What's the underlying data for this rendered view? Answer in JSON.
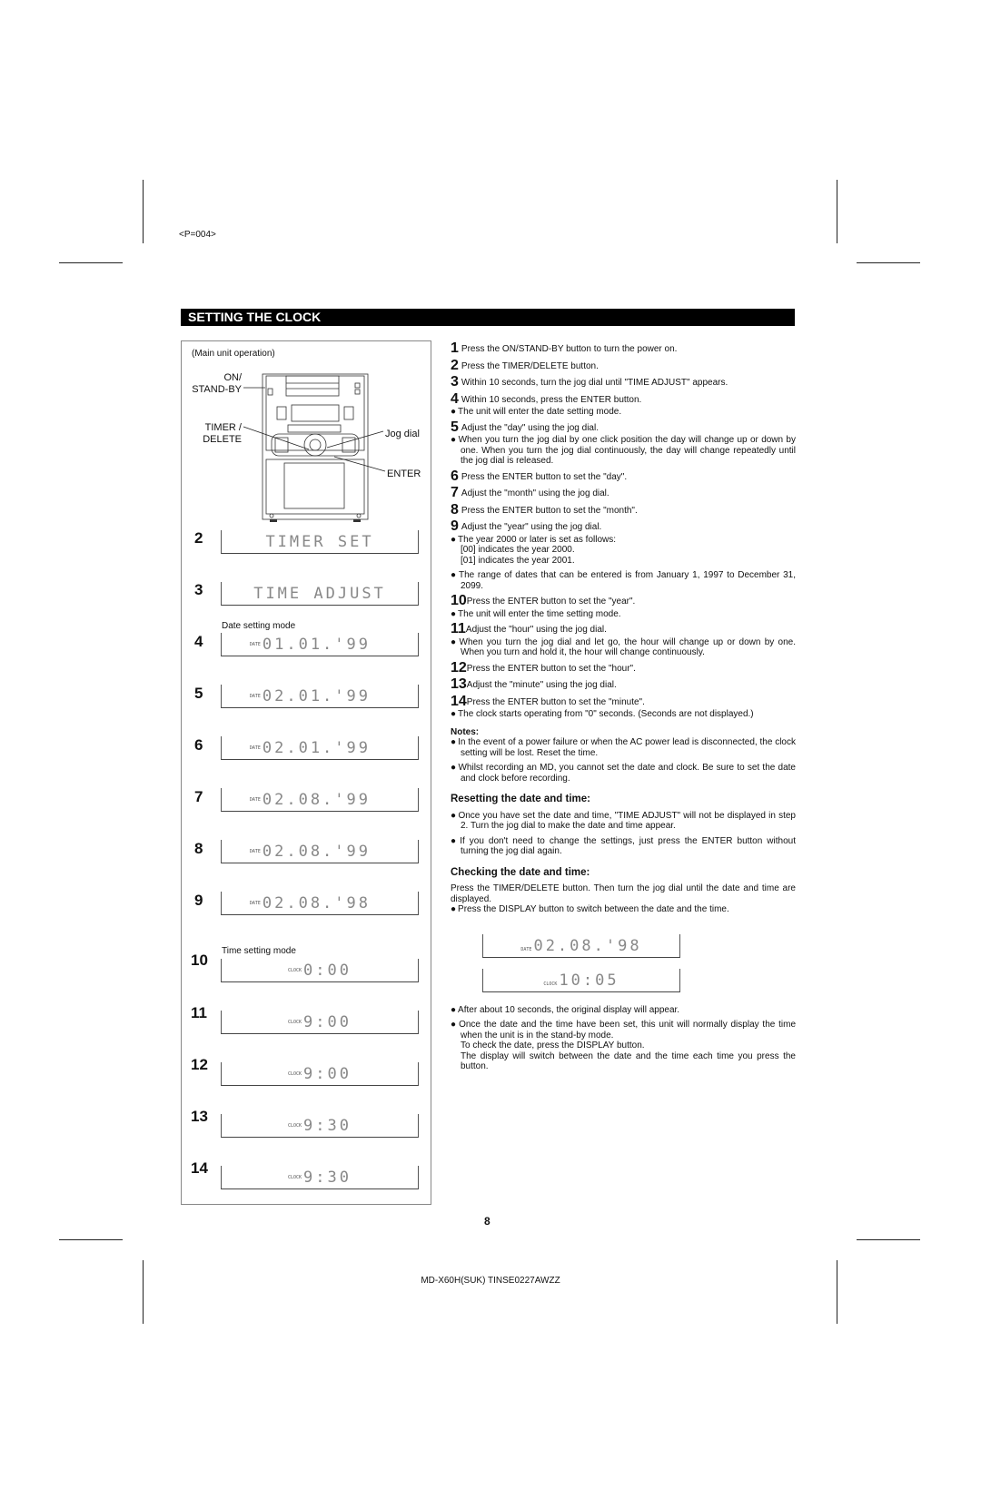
{
  "page_code": "<P=004>",
  "title": "SETTING THE CLOCK",
  "left_panel": {
    "caption": "(Main unit operation)",
    "labels": {
      "on_standby": "ON/\nSTAND-BY",
      "timer_delete": "TIMER /\nDELETE",
      "jog_dial": "Jog dial",
      "enter": "ENTER"
    },
    "date_mode_label": "Date setting mode",
    "time_mode_label": "Time setting mode",
    "displays": [
      {
        "step": "2",
        "text": "TIMER SET",
        "indicator": ""
      },
      {
        "step": "3",
        "text": "TIME ADJUST",
        "indicator": ""
      },
      {
        "step": "4",
        "text": "01.01.'99",
        "indicator": "DATE"
      },
      {
        "step": "5",
        "text": "02.01.'99",
        "indicator": "DATE"
      },
      {
        "step": "6",
        "text": "02.01.'99",
        "indicator": "DATE"
      },
      {
        "step": "7",
        "text": "02.08.'99",
        "indicator": "DATE"
      },
      {
        "step": "8",
        "text": "02.08.'99",
        "indicator": "DATE"
      },
      {
        "step": "9",
        "text": "02.08.'98",
        "indicator": "DATE"
      },
      {
        "step": "10",
        "text": "0:00",
        "indicator": "CLOCK"
      },
      {
        "step": "11",
        "text": "9:00",
        "indicator": "CLOCK"
      },
      {
        "step": "12",
        "text": "9:00",
        "indicator": "CLOCK"
      },
      {
        "step": "13",
        "text": "9:30",
        "indicator": "CLOCK"
      },
      {
        "step": "14",
        "text": "9:30",
        "indicator": "CLOCK"
      }
    ]
  },
  "steps": {
    "s1": {
      "n": "1",
      "text": "Press the ON/STAND-BY button to turn the power on."
    },
    "s2": {
      "n": "2",
      "text": "Press the TIMER/DELETE button."
    },
    "s3": {
      "n": "3",
      "text": "Within 10 seconds, turn the jog dial until \"TIME ADJUST\" appears."
    },
    "s4": {
      "n": "4",
      "text": "Within 10 seconds, press the ENTER button."
    },
    "b4": "The unit will enter the date setting mode.",
    "s5": {
      "n": "5",
      "text": "Adjust the \"day\" using the jog dial."
    },
    "b5": "When you turn the jog dial by one click position the day will change up or down by one. When you turn the jog dial continuously, the day will change repeatedly until the jog dial is released.",
    "s6": {
      "n": "6",
      "text": "Press the ENTER button to set the \"day\"."
    },
    "s7": {
      "n": "7",
      "text": "Adjust the \"month\" using the jog dial."
    },
    "s8": {
      "n": "8",
      "text": "Press the ENTER button to set the \"month\"."
    },
    "s9": {
      "n": "9",
      "text": "Adjust the \"year\" using the jog dial."
    },
    "b9a": "The year 2000 or later is set as follows:",
    "b9a_l1": "[00] indicates the year 2000.",
    "b9a_l2": "[01] indicates the year 2001.",
    "b9b": "The range of dates that can be entered is from January 1, 1997 to December 31, 2099.",
    "s10": {
      "n": "10",
      "text": "Press the ENTER button to set the \"year\"."
    },
    "b10": "The unit will enter the time setting mode.",
    "s11": {
      "n": "11",
      "text": "Adjust the \"hour\" using the jog dial."
    },
    "b11": "When you turn the jog dial and let go, the hour will change up or down by one. When you turn and hold it, the hour will change continuously.",
    "s12": {
      "n": "12",
      "text": "Press the ENTER button to set the \"hour\"."
    },
    "s13": {
      "n": "13",
      "text": "Adjust the \"minute\" using the jog dial."
    },
    "s14": {
      "n": "14",
      "text": "Press the ENTER button to set the \"minute\"."
    },
    "b14": "The clock starts operating from \"0\" seconds. (Seconds are not displayed.)"
  },
  "notes": {
    "heading": "Notes:",
    "n1": "In the event of a power failure or when the AC power lead is disconnected, the clock setting will be lost. Reset the time.",
    "n2": "Whilst recording an MD, you cannot set the date and clock. Be sure to set the date and clock before recording."
  },
  "resetting": {
    "heading": "Resetting the date and time:",
    "b1": "Once you have set the date and time, \"TIME ADJUST\" will not be displayed in step 2. Turn the jog dial to make the date and time appear.",
    "b2": "If you don't need to change the settings, just press the ENTER button without turning the jog dial again."
  },
  "checking": {
    "heading": "Checking the date and time:",
    "para": "Press the TIMER/DELETE button. Then turn the jog dial until the date and time are displayed.",
    "b1": "Press the DISPLAY button to switch between the date and the time.",
    "display_date": "02.08.'98",
    "display_date_ind": "DATE",
    "display_time": "10:05",
    "display_time_ind": "CLOCK",
    "b2": "After about 10 seconds, the original display will appear.",
    "b3": "Once the date and the time have been set, this unit will normally display the time when the unit is in the stand-by mode.",
    "b3_l2": "To check the date, press the DISPLAY button.",
    "b3_l3": "The display will switch between the date and the time each time you press the button."
  },
  "page_number": "8",
  "footer": "MD-X60H(SUK) TINSE0227AWZZ"
}
